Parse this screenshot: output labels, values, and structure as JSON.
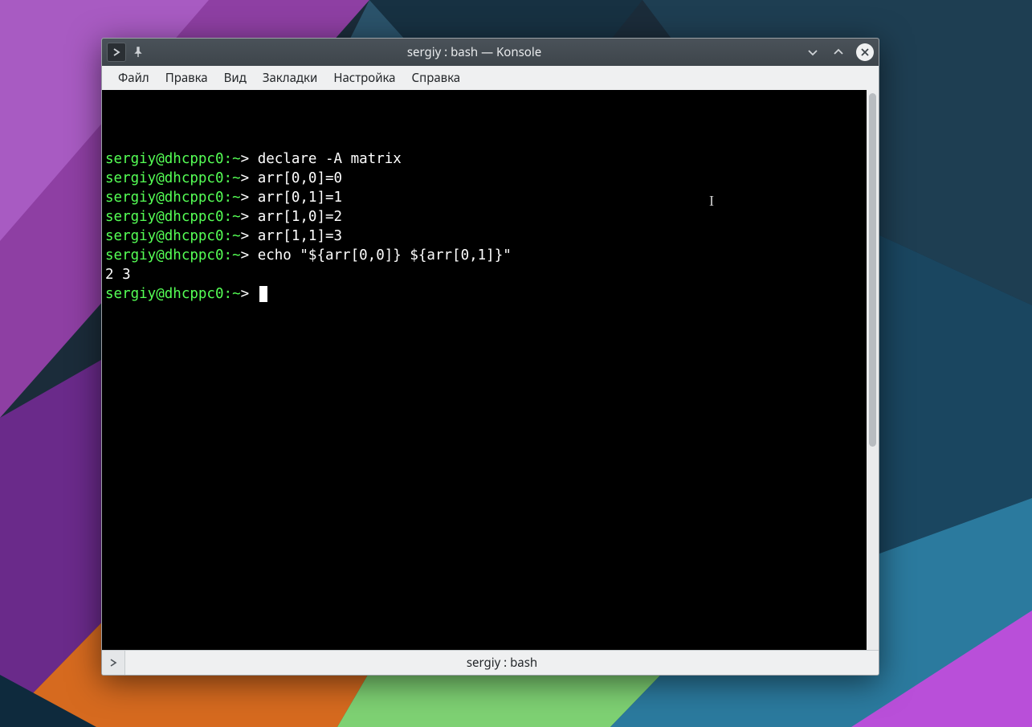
{
  "window": {
    "title": "sergiy : bash — Konsole"
  },
  "menubar": {
    "items": [
      "Файл",
      "Правка",
      "Вид",
      "Закладки",
      "Настройка",
      "Справка"
    ]
  },
  "terminal": {
    "prompt": {
      "user_host": "sergiy@dhcppc0",
      "path": "~",
      "symbol": ">"
    },
    "lines": [
      {
        "type": "cmd",
        "text": "declare -A matrix"
      },
      {
        "type": "cmd",
        "text": "arr[0,0]=0"
      },
      {
        "type": "cmd",
        "text": "arr[0,1]=1"
      },
      {
        "type": "cmd",
        "text": "arr[1,0]=2"
      },
      {
        "type": "cmd",
        "text": "arr[1,1]=3"
      },
      {
        "type": "cmd",
        "text": "echo \"${arr[0,0]} ${arr[0,1]}\""
      },
      {
        "type": "out",
        "text": "2 3"
      },
      {
        "type": "cmd",
        "text": "",
        "cursor": true
      }
    ]
  },
  "tabbar": {
    "active_tab": "sergiy : bash"
  }
}
